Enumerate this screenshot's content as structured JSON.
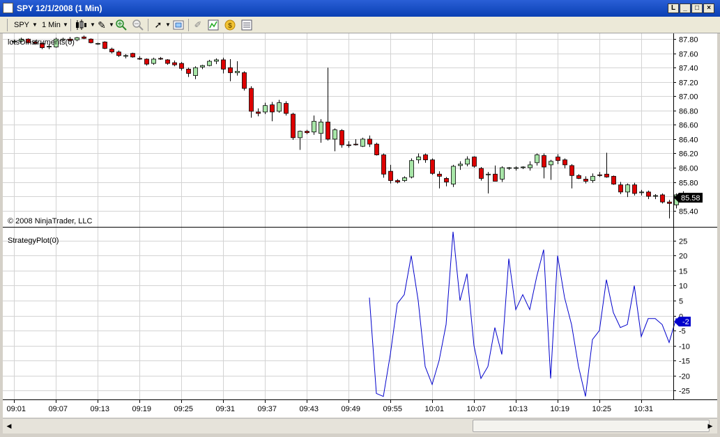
{
  "window": {
    "title": "SPY  12/1/2008 (1 Min)"
  },
  "toolbar": {
    "instrument": "SPY",
    "interval": "1 Min",
    "icons": [
      "candlestick-icon",
      "draw-pencil-icon",
      "zoom-in-icon",
      "zoom-out-icon",
      "cursor-icon",
      "chart-props-icon",
      "crosshair-icon",
      "indicator-icon",
      "strategy-icon",
      "data-box-icon"
    ]
  },
  "colors": {
    "up_candle": "#a8e6a8",
    "down_candle": "#dd0000",
    "plot_line": "#0000cc",
    "grid": "#d3d3d3",
    "price_marker": "#000000",
    "plot_marker": "#0000cc"
  },
  "price_panel": {
    "label": "lotsOinstruments(0)",
    "copyright": "© 2008 NinjaTrader, LLC",
    "current_price": "85.58"
  },
  "strategy_panel": {
    "label": "StrategyPlot(0)",
    "current_value": "-2"
  },
  "chart_data": {
    "type": "candlestick",
    "x_tick_labels": [
      "09:01",
      "09:07",
      "09:13",
      "09:19",
      "09:25",
      "09:31",
      "09:37",
      "09:43",
      "09:49",
      "09:55",
      "10:01",
      "10:07",
      "10:13",
      "10:19",
      "10:25",
      "10:31"
    ],
    "price_axis": {
      "ticks": [
        "87.80",
        "87.60",
        "87.40",
        "87.20",
        "87.00",
        "86.80",
        "86.60",
        "86.40",
        "86.20",
        "86.00",
        "85.80",
        "85.60",
        "85.40"
      ],
      "ylim": [
        85.25,
        87.88
      ]
    },
    "candles": [
      [
        87.76,
        87.79,
        87.73,
        87.77
      ],
      [
        87.77,
        87.82,
        87.75,
        87.8
      ],
      [
        87.8,
        87.81,
        87.74,
        87.75
      ],
      [
        87.76,
        87.78,
        87.72,
        87.74
      ],
      [
        87.74,
        87.76,
        87.66,
        87.68
      ],
      [
        87.69,
        87.73,
        87.66,
        87.7
      ],
      [
        87.69,
        87.82,
        87.68,
        87.8
      ],
      [
        87.8,
        87.82,
        87.79,
        87.8
      ],
      [
        87.8,
        87.83,
        87.76,
        87.78
      ],
      [
        87.79,
        87.83,
        87.77,
        87.82
      ],
      [
        87.83,
        87.85,
        87.8,
        87.81
      ],
      [
        87.8,
        87.81,
        87.74,
        87.75
      ],
      [
        87.74,
        87.75,
        87.72,
        87.74
      ],
      [
        87.76,
        87.77,
        87.66,
        87.67
      ],
      [
        87.66,
        87.68,
        87.6,
        87.62
      ],
      [
        87.62,
        87.64,
        87.55,
        87.57
      ],
      [
        87.56,
        87.59,
        87.53,
        87.57
      ],
      [
        87.6,
        87.61,
        87.54,
        87.55
      ],
      [
        87.53,
        87.56,
        87.51,
        87.52
      ],
      [
        87.52,
        87.53,
        87.43,
        87.45
      ],
      [
        87.46,
        87.54,
        87.44,
        87.52
      ],
      [
        87.53,
        87.55,
        87.51,
        87.52
      ],
      [
        87.51,
        87.52,
        87.44,
        87.46
      ],
      [
        87.47,
        87.5,
        87.42,
        87.44
      ],
      [
        87.46,
        87.48,
        87.36,
        87.39
      ],
      [
        87.38,
        87.4,
        87.27,
        87.32
      ],
      [
        87.29,
        87.42,
        87.24,
        87.4
      ],
      [
        87.41,
        87.44,
        87.38,
        87.43
      ],
      [
        87.43,
        87.51,
        87.42,
        87.49
      ],
      [
        87.49,
        87.53,
        87.45,
        87.51
      ],
      [
        87.51,
        87.54,
        87.32,
        87.38
      ],
      [
        87.4,
        87.52,
        87.21,
        87.33
      ],
      [
        87.33,
        87.49,
        87.29,
        87.35
      ],
      [
        87.33,
        87.35,
        87.08,
        87.11
      ],
      [
        87.11,
        87.14,
        86.7,
        86.79
      ],
      [
        86.78,
        86.83,
        86.72,
        86.76
      ],
      [
        86.78,
        86.91,
        86.75,
        86.87
      ],
      [
        86.88,
        86.92,
        86.65,
        86.78
      ],
      [
        86.79,
        86.95,
        86.77,
        86.91
      ],
      [
        86.9,
        86.93,
        86.73,
        86.76
      ],
      [
        86.75,
        86.77,
        86.39,
        86.42
      ],
      [
        86.42,
        86.52,
        86.25,
        86.51
      ],
      [
        86.51,
        86.53,
        86.47,
        86.49
      ],
      [
        86.5,
        86.73,
        86.46,
        86.65
      ],
      [
        86.48,
        86.68,
        86.35,
        86.64
      ],
      [
        86.64,
        87.4,
        86.38,
        86.4
      ],
      [
        86.4,
        86.55,
        86.23,
        86.53
      ],
      [
        86.52,
        86.54,
        86.28,
        86.32
      ],
      [
        86.32,
        86.37,
        86.28,
        86.31
      ],
      [
        86.33,
        86.4,
        86.31,
        86.32
      ],
      [
        86.3,
        86.42,
        86.29,
        86.4
      ],
      [
        86.4,
        86.45,
        86.29,
        86.33
      ],
      [
        86.33,
        86.35,
        86.17,
        86.18
      ],
      [
        86.18,
        86.2,
        85.86,
        85.91
      ],
      [
        85.95,
        86.04,
        85.78,
        85.82
      ],
      [
        85.82,
        85.84,
        85.78,
        85.8
      ],
      [
        85.82,
        85.88,
        85.8,
        85.86
      ],
      [
        85.87,
        86.13,
        85.85,
        86.1
      ],
      [
        86.11,
        86.2,
        86.06,
        86.15
      ],
      [
        86.18,
        86.2,
        86.07,
        86.11
      ],
      [
        86.11,
        86.13,
        85.9,
        85.92
      ],
      [
        85.91,
        85.95,
        85.71,
        85.88
      ],
      [
        85.85,
        85.87,
        85.74,
        85.8
      ],
      [
        85.77,
        86.04,
        85.73,
        86.02
      ],
      [
        86.03,
        86.09,
        85.97,
        86.05
      ],
      [
        86.05,
        86.16,
        86.02,
        86.12
      ],
      [
        86.15,
        86.16,
        86.0,
        86.02
      ],
      [
        85.99,
        86.01,
        85.82,
        85.85
      ],
      [
        85.9,
        85.94,
        85.64,
        85.91
      ],
      [
        85.91,
        86.03,
        85.81,
        85.81
      ],
      [
        85.84,
        86.02,
        85.8,
        86.0
      ],
      [
        85.99,
        86.01,
        85.97,
        86.0
      ],
      [
        85.99,
        86.02,
        85.96,
        86.0
      ],
      [
        86.0,
        86.02,
        85.98,
        86.01
      ],
      [
        86.0,
        86.09,
        85.96,
        86.04
      ],
      [
        86.07,
        86.2,
        86.03,
        86.18
      ],
      [
        86.17,
        86.2,
        85.85,
        86.01
      ],
      [
        86.04,
        86.11,
        85.83,
        86.09
      ],
      [
        86.15,
        86.19,
        86.05,
        86.1
      ],
      [
        86.11,
        86.13,
        85.99,
        86.04
      ],
      [
        86.03,
        86.05,
        85.71,
        85.89
      ],
      [
        85.89,
        85.91,
        85.84,
        85.85
      ],
      [
        85.84,
        85.88,
        85.78,
        85.81
      ],
      [
        85.82,
        85.92,
        85.79,
        85.88
      ],
      [
        85.9,
        85.94,
        85.87,
        85.89
      ],
      [
        85.91,
        86.21,
        85.86,
        85.87
      ],
      [
        85.88,
        85.89,
        85.76,
        85.77
      ],
      [
        85.76,
        85.8,
        85.63,
        85.66
      ],
      [
        85.66,
        85.78,
        85.59,
        85.76
      ],
      [
        85.76,
        85.79,
        85.61,
        85.64
      ],
      [
        85.65,
        85.69,
        85.61,
        85.66
      ],
      [
        85.66,
        85.68,
        85.56,
        85.6
      ],
      [
        85.6,
        85.63,
        85.56,
        85.61
      ],
      [
        85.62,
        85.64,
        85.5,
        85.52
      ],
      [
        85.52,
        85.55,
        85.29,
        85.5
      ],
      [
        85.48,
        85.64,
        85.43,
        85.62
      ],
      [
        85.63,
        85.67,
        85.56,
        85.58
      ]
    ],
    "strategy_axis": {
      "ticks": [
        "25",
        "20",
        "15",
        "10",
        "5",
        "0",
        "-5",
        "-10",
        "-15",
        "-20",
        "-25"
      ],
      "ylim": [
        -28,
        28
      ]
    },
    "strategy_series": {
      "start_index": 51,
      "values": [
        6,
        -26,
        -27,
        -13,
        4,
        7,
        20,
        5,
        -17,
        -23,
        -15,
        -3,
        28,
        5,
        14,
        -10,
        -21,
        -17,
        -4,
        -13,
        19,
        2,
        7,
        2,
        13,
        22,
        -21,
        20,
        6,
        -3,
        -17,
        -27,
        -8,
        -5,
        12,
        1,
        -4,
        -3,
        10,
        -7,
        -1,
        -1,
        -3,
        -9,
        -1,
        -2
      ]
    }
  }
}
